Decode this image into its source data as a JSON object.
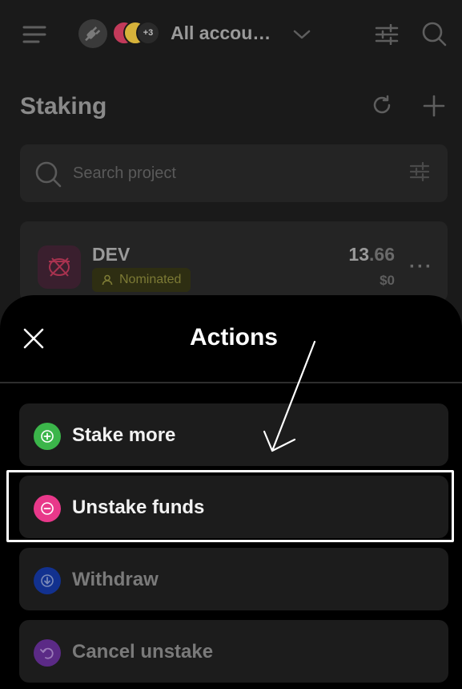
{
  "topbar": {
    "menu_icon": "menu-icon",
    "plug_icon": "plug-icon",
    "avatars_extra": "+3",
    "account_name": "All accou…",
    "chevron_icon": "chevron-down-icon",
    "filter_icon": "sliders-icon",
    "search_icon": "search-icon"
  },
  "page": {
    "title": "Staking",
    "reload_icon": "reload-icon",
    "add_icon": "plus-icon"
  },
  "search": {
    "placeholder": "Search project",
    "value": ""
  },
  "stake_item": {
    "token": "DEV",
    "status": "Nominated",
    "amount_int": "13",
    "amount_dec": ".66",
    "fiat": "$0",
    "more_label": "···"
  },
  "sheet": {
    "title": "Actions",
    "actions": [
      {
        "label": "Stake more",
        "icon": "plus-circle-icon",
        "color": "#3bb54a"
      },
      {
        "label": "Unstake funds",
        "icon": "minus-circle-icon",
        "color": "#e8388a"
      },
      {
        "label": "Withdraw",
        "icon": "download-circle-icon",
        "color": "#12318f"
      },
      {
        "label": "Cancel unstake",
        "icon": "undo-circle-icon",
        "color": "#5b2a86"
      }
    ]
  },
  "colors": {
    "sheet_bg": "#000000",
    "card_bg": "#1c1c1c",
    "badge_text": "#7c7a35"
  }
}
